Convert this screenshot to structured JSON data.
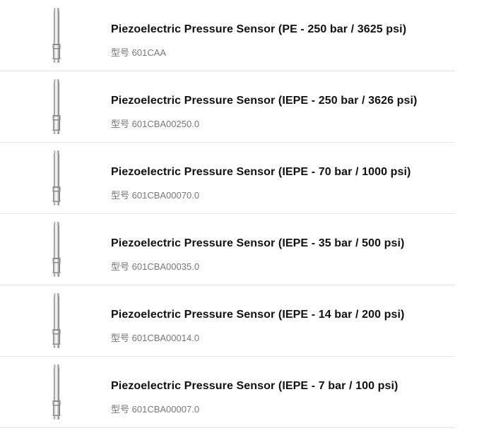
{
  "products": [
    {
      "title": "Piezoelectric Pressure Sensor (PE - 250 bar / 3625 psi)",
      "model_prefix": "型号",
      "model": "601CAA",
      "image_icon": "pressure-sensor-icon"
    },
    {
      "title": "Piezoelectric Pressure Sensor (IEPE - 250 bar / 3626 psi)",
      "model_prefix": "型号",
      "model": "601CBA00250.0",
      "image_icon": "pressure-sensor-icon"
    },
    {
      "title": "Piezoelectric Pressure Sensor (IEPE - 70 bar / 1000 psi)",
      "model_prefix": "型号",
      "model": "601CBA00070.0",
      "image_icon": "pressure-sensor-icon"
    },
    {
      "title": "Piezoelectric Pressure Sensor (IEPE - 35 bar / 500 psi)",
      "model_prefix": "型号",
      "model": "601CBA00035.0",
      "image_icon": "pressure-sensor-icon"
    },
    {
      "title": "Piezoelectric Pressure Sensor (IEPE - 14 bar / 200 psi)",
      "model_prefix": "型号",
      "model": "601CBA00014.0",
      "image_icon": "pressure-sensor-icon"
    },
    {
      "title": "Piezoelectric Pressure Sensor (IEPE - 7 bar / 100 psi)",
      "model_prefix": "型号",
      "model": "601CBA00007.0",
      "image_icon": "pressure-sensor-icon"
    }
  ]
}
